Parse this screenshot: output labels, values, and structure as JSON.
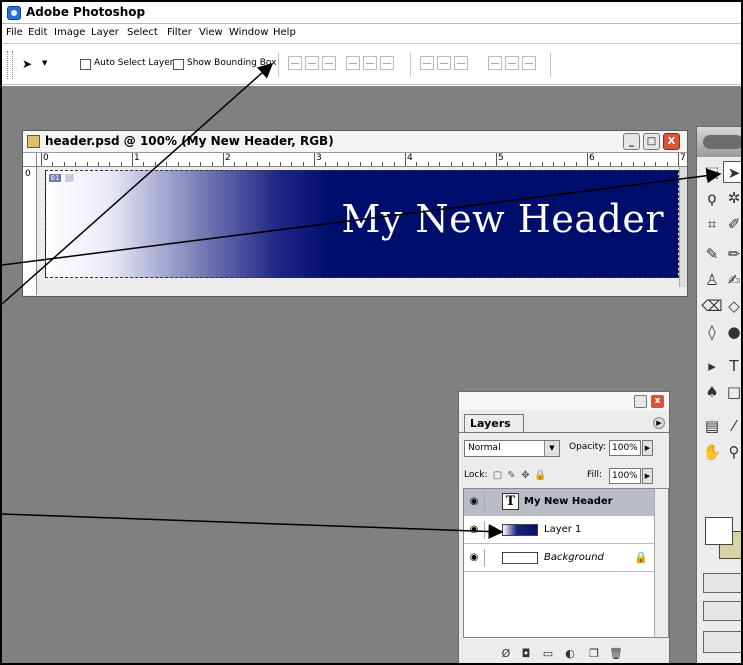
{
  "app": {
    "title": "Adobe Photoshop"
  },
  "menu": [
    "File",
    "Edit",
    "Image",
    "Layer",
    "Select",
    "Filter",
    "View",
    "Window",
    "Help"
  ],
  "options": {
    "tool_preset_icon": "move-tool-icon",
    "auto_select_label": "Auto Select Layer",
    "show_bounding_label": "Show Bounding Box"
  },
  "document": {
    "title": "header.psd @ 100% (My New Header, RGB)",
    "ruler_labels": [
      "0",
      "1",
      "2",
      "3",
      "4",
      "5",
      "6",
      "7"
    ],
    "vruler_label": "0",
    "slice_badge": "01",
    "banner_text": "My New Header",
    "minimize": "_",
    "maximize": "□",
    "close": "X"
  },
  "layers": {
    "tab_label": "Layers",
    "blend_mode": "Normal",
    "opacity_label": "Opacity:",
    "opacity_value": "100%",
    "lock_label": "Lock:",
    "fill_label": "Fill:",
    "fill_value": "100%",
    "close": "x",
    "items": [
      {
        "name": "My New Header",
        "type": "text",
        "selected": true,
        "type_glyph": "T"
      },
      {
        "name": "Layer 1",
        "type": "gradient",
        "selected": false
      },
      {
        "name": "Background",
        "type": "background",
        "selected": false,
        "locked": true
      }
    ]
  },
  "colors": {
    "workspace": "#808080",
    "banner_dark": "#000e6b",
    "close_red": "#d9533b",
    "background_color_swatch": "#d7d2a0"
  }
}
